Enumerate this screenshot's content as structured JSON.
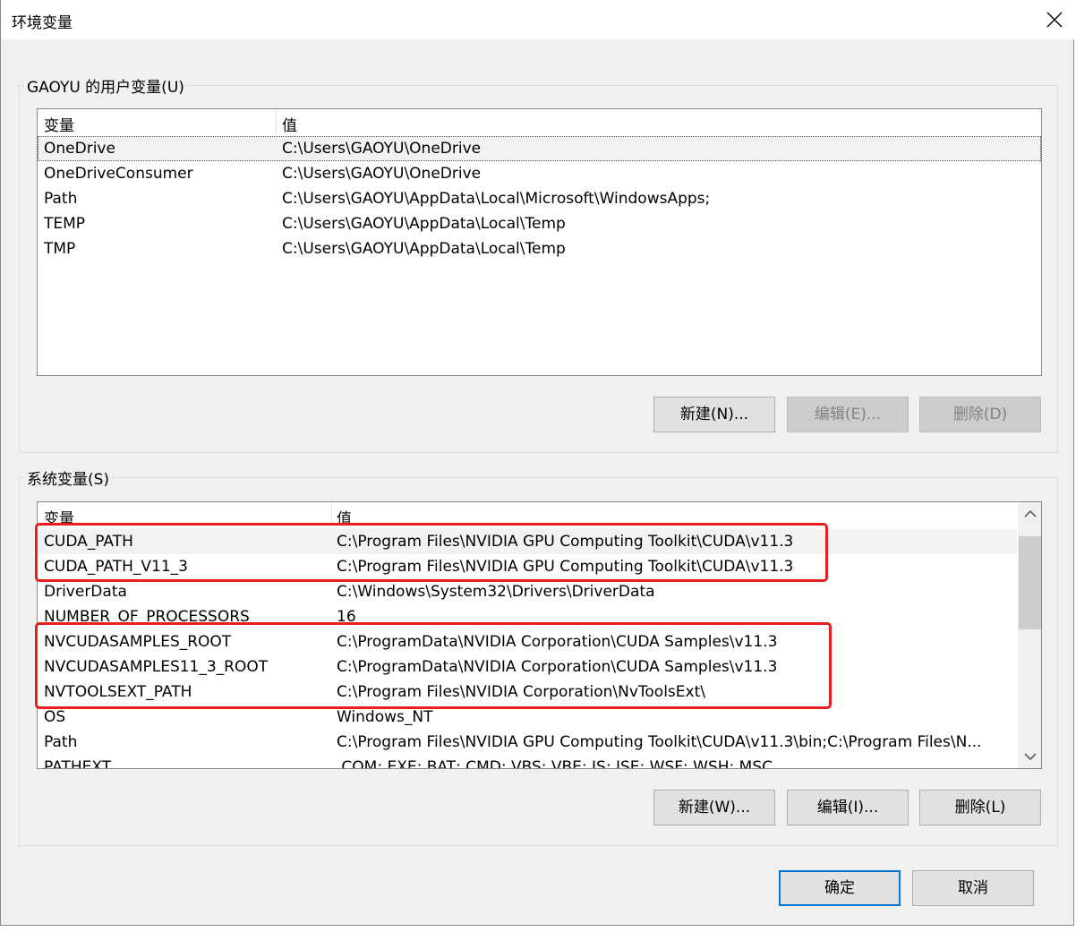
{
  "window": {
    "title": "环境变量"
  },
  "user_vars": {
    "group_label": "GAOYU 的用户变量(U)",
    "columns": [
      "变量",
      "值"
    ],
    "rows": [
      {
        "name": "OneDrive",
        "value": "C:\\Users\\GAOYU\\OneDrive"
      },
      {
        "name": "OneDriveConsumer",
        "value": "C:\\Users\\GAOYU\\OneDrive"
      },
      {
        "name": "Path",
        "value": "C:\\Users\\GAOYU\\AppData\\Local\\Microsoft\\WindowsApps;"
      },
      {
        "name": "TEMP",
        "value": "C:\\Users\\GAOYU\\AppData\\Local\\Temp"
      },
      {
        "name": "TMP",
        "value": "C:\\Users\\GAOYU\\AppData\\Local\\Temp"
      }
    ],
    "buttons": {
      "new": "新建(N)...",
      "edit": "编辑(E)...",
      "delete": "删除(D)"
    }
  },
  "system_vars": {
    "group_label": "系统变量(S)",
    "columns": [
      "变量",
      "值"
    ],
    "rows": [
      {
        "name": "CUDA_PATH",
        "value": "C:\\Program Files\\NVIDIA GPU Computing Toolkit\\CUDA\\v11.3"
      },
      {
        "name": "CUDA_PATH_V11_3",
        "value": "C:\\Program Files\\NVIDIA GPU Computing Toolkit\\CUDA\\v11.3"
      },
      {
        "name": "DriverData",
        "value": "C:\\Windows\\System32\\Drivers\\DriverData"
      },
      {
        "name": "NUMBER_OF_PROCESSORS",
        "value": "16"
      },
      {
        "name": "NVCUDASAMPLES_ROOT",
        "value": "C:\\ProgramData\\NVIDIA Corporation\\CUDA Samples\\v11.3"
      },
      {
        "name": "NVCUDASAMPLES11_3_ROOT",
        "value": "C:\\ProgramData\\NVIDIA Corporation\\CUDA Samples\\v11.3"
      },
      {
        "name": "NVTOOLSEXT_PATH",
        "value": "C:\\Program Files\\NVIDIA Corporation\\NvToolsExt\\"
      },
      {
        "name": "OS",
        "value": "Windows_NT"
      },
      {
        "name": "Path",
        "value": "C:\\Program Files\\NVIDIA GPU Computing Toolkit\\CUDA\\v11.3\\bin;C:\\Program Files\\N..."
      },
      {
        "name": "PATHEXT",
        "value": ".COM;.EXE;.BAT;.CMD;.VBS;.VBE;.JS;.JSE;.WSF;.WSH;.MSC"
      }
    ],
    "buttons": {
      "new": "新建(W)...",
      "edit": "编辑(I)...",
      "delete": "删除(L)"
    }
  },
  "footer": {
    "ok": "确定",
    "cancel": "取消"
  },
  "colors": {
    "annotation": "#e81f1f",
    "focus": "#0078d7"
  },
  "icons": {
    "close": "close-icon",
    "scroll_up": "chevron-up-icon",
    "scroll_down": "chevron-down-icon"
  }
}
